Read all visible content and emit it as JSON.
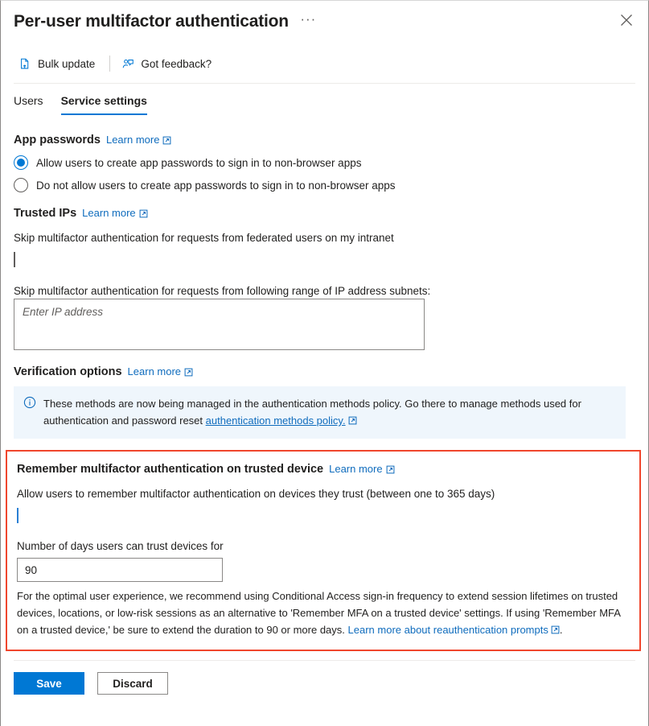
{
  "header": {
    "title": "Per-user multifactor authentication",
    "more_icon": "ellipsis-icon",
    "more_label": "···",
    "close_icon": "close-icon"
  },
  "command_bar": {
    "items": [
      {
        "label": "Bulk update",
        "icon": "document-upload-icon"
      },
      {
        "label": "Got feedback?",
        "icon": "person-feedback-icon"
      }
    ]
  },
  "tabs": [
    {
      "label": "Users",
      "active": false
    },
    {
      "label": "Service settings",
      "active": true
    }
  ],
  "sections": {
    "app_passwords": {
      "title": "App passwords",
      "learn_more": "Learn more",
      "options": [
        {
          "label": "Allow users to create app passwords to sign in to non-browser apps",
          "selected": true
        },
        {
          "label": "Do not allow users to create app passwords to sign in to non-browser apps",
          "selected": false
        }
      ]
    },
    "trusted_ips": {
      "title": "Trusted IPs",
      "learn_more": "Learn more",
      "federated_label": "Skip multifactor authentication for requests from federated users on my intranet",
      "federated_checked": false,
      "subnets_label": "Skip multifactor authentication for requests from following range of IP address subnets:",
      "subnets_value": "",
      "subnets_placeholder": "Enter IP address"
    },
    "verification_options": {
      "title": "Verification options",
      "learn_more": "Learn more",
      "banner": {
        "icon": "info-icon",
        "text_before": "These methods are now being managed in the authentication methods policy. Go there to manage methods used for authentication and password reset",
        "link": "authentication methods policy.",
        "link_icon": "external-link-icon"
      }
    },
    "remember_mfa": {
      "title": "Remember multifactor authentication on trusted device",
      "learn_more": "Learn more",
      "allow_label": "Allow users to remember multifactor authentication on devices they trust (between one to 365 days)",
      "allow_checked": true,
      "days_label": "Number of days users can trust devices for",
      "days_value": "90",
      "note_before": "For the optimal user experience, we recommend using Conditional Access sign-in frequency to extend session lifetimes on trusted devices, locations, or low-risk sessions as an alternative to 'Remember MFA on a trusted device' settings. If using 'Remember MFA on a trusted device,' be sure to extend the duration to 90 or more days.",
      "note_link": "Learn more about reauthentication prompts",
      "note_after": ".",
      "highlight_color": "#f0462d"
    }
  },
  "footer": {
    "save_label": "Save",
    "discard_label": "Discard"
  },
  "colors": {
    "accent": "#0078d4",
    "link": "#0f6cbd",
    "banner_bg": "#eff6fc",
    "highlight": "#f0462d"
  }
}
